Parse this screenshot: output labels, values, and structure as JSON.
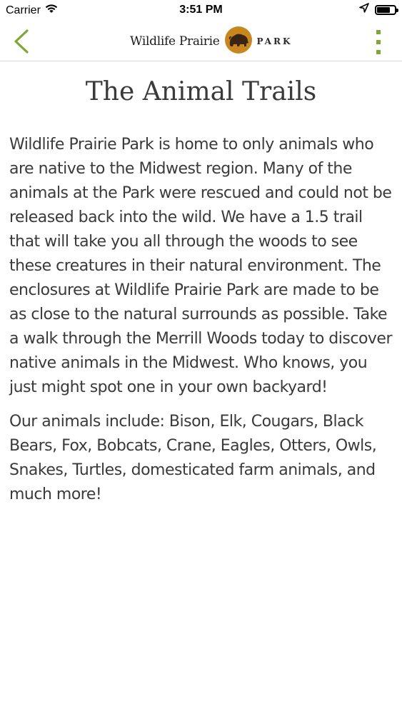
{
  "status_bar": {
    "carrier": "Carrier",
    "time": "3:51 PM"
  },
  "nav": {
    "logo_text": "Wildlife Prairie",
    "logo_park": "PARK",
    "accent_color": "#7da833",
    "logo_color": "#c8861f"
  },
  "page": {
    "title": "The Animal Trails",
    "paragraphs": [
      "Wildlife Prairie Park is home to only animals who are native to the Midwest region. Many of the animals at the Park were rescued and could not be released back into the wild. We have a 1.5 trail that will take you all through the woods to see these creatures in their natural environment. The enclosures at Wildlife Prairie Park are made to be as close to the natural surrounds as possible. Take a walk through the Merrill Woods today to discover native animals in the Midwest. Who knows, you just might spot one in your own backyard!",
      "Our animals include: Bison, Elk, Cougars, Black Bears, Fox, Bobcats, Crane, Eagles, Otters, Owls, Snakes, Turtles, domesticated farm animals, and much more!"
    ]
  }
}
